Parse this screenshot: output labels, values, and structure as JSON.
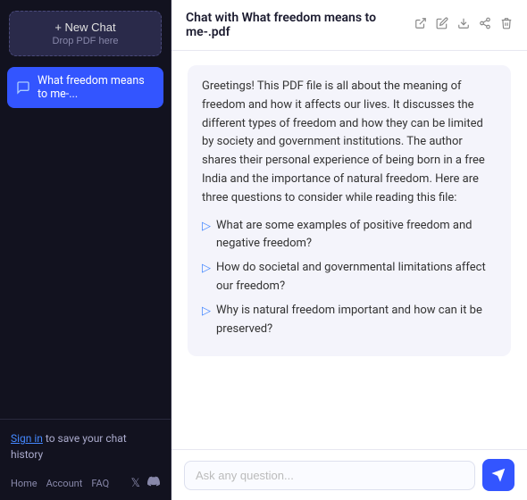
{
  "sidebar": {
    "new_chat_label": "+ New Chat",
    "drop_pdf_label": "Drop PDF here",
    "chat_items": [
      {
        "id": 1,
        "label": "What freedom means to me-..."
      }
    ],
    "sign_in_text": "to save your chat history",
    "sign_in_link": "Sign in",
    "nav_links": [
      "Home",
      "Account",
      "FAQ"
    ]
  },
  "main": {
    "header": {
      "title": "Chat with What freedom means to me-.pdf"
    },
    "message": {
      "body": "Greetings! This PDF file is all about the meaning of freedom and how it affects our lives. It discusses the different types of freedom and how they can be limited by society and government institutions. The author shares their personal experience of being born in a free India and the importance of natural freedom. Here are three questions to consider while reading this file:",
      "questions": [
        "What are some examples of positive freedom and negative freedom?",
        "How do societal and governmental limitations affect our freedom?",
        "Why is natural freedom important and how can it be preserved?"
      ]
    },
    "input": {
      "placeholder": "Ask any question..."
    }
  }
}
